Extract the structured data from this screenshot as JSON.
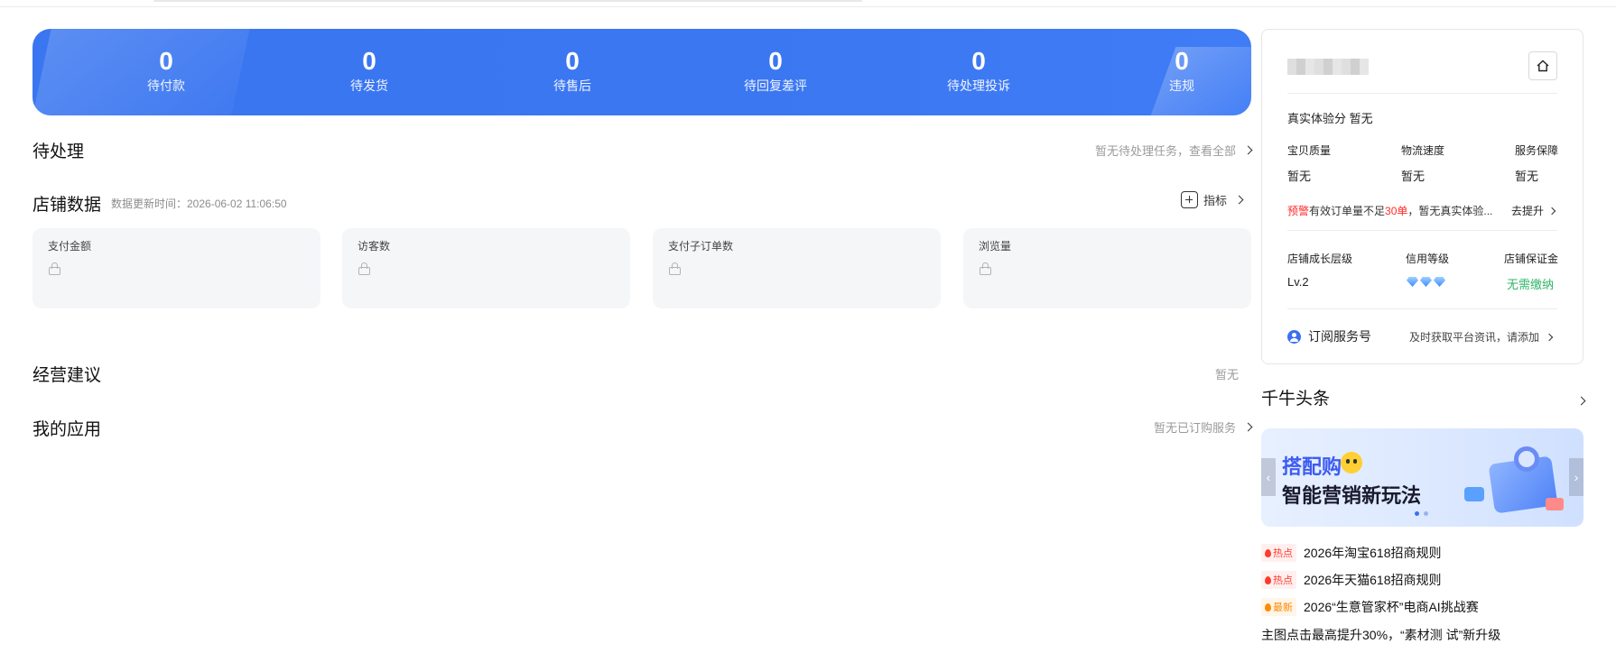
{
  "banner_stats": [
    {
      "value": "0",
      "label": "待付款"
    },
    {
      "value": "0",
      "label": "待发货"
    },
    {
      "value": "0",
      "label": "待售后"
    },
    {
      "value": "0",
      "label": "待回复差评"
    },
    {
      "value": "0",
      "label": "待处理投诉"
    },
    {
      "value": "0",
      "label": "违规"
    }
  ],
  "pending": {
    "title": "待处理",
    "right_text": "暂无待处理任务，查看全部"
  },
  "shop_data": {
    "title": "店铺数据",
    "update_note": "数据更新时间：2026-06-02 11:06:50",
    "metric_button": "指标",
    "cards": [
      "支付金额",
      "访客数",
      "支付子订单数",
      "浏览量"
    ]
  },
  "advice": {
    "title": "经营建议",
    "right_text": "暂无"
  },
  "apps": {
    "title": "我的应用",
    "right_text": "暂无已订购服务"
  },
  "shop_panel": {
    "experience_label": "真实体验分",
    "experience_value": "暂无",
    "scores": [
      {
        "label": "宝贝质量",
        "value": "暂无"
      },
      {
        "label": "物流速度",
        "value": "暂无"
      },
      {
        "label": "服务保障",
        "value": "暂无"
      }
    ],
    "warning_tag": "预警",
    "warning_text_1": "有效订单量不足",
    "warning_count": "30单",
    "warning_text_2": "，暂无真实体验...",
    "improve_link": "去提升",
    "growth_label": "店铺成长层级",
    "growth_value": "Lv.2",
    "credit_label": "信用等级",
    "deposit_label": "店铺保证金",
    "deposit_value": "无需缴纳",
    "subscribe_label": "订阅服务号",
    "subscribe_hint": "及时获取平台资讯，请添加"
  },
  "news": {
    "title": "千牛头条",
    "banner_line1": "搭配购",
    "banner_line2": "智能营销新玩法",
    "items": [
      {
        "tag": "热点",
        "tag_type": "hot",
        "text": "2026年淘宝618招商规则"
      },
      {
        "tag": "热点",
        "tag_type": "hot",
        "text": "2026年天猫618招商规则"
      },
      {
        "tag": "最新",
        "tag_type": "new",
        "text": "2026“生意管家杯”电商AI挑战赛"
      }
    ],
    "plain_item": "主图点击最高提升30%，“素材测 试”新升级"
  },
  "colors": {
    "banner_blue": "#3c77f2",
    "warning_red": "#ff2a2a",
    "deposit_green": "#2fb56a",
    "hot_tag": "#ff3b30",
    "new_tag": "#ff8a00"
  }
}
